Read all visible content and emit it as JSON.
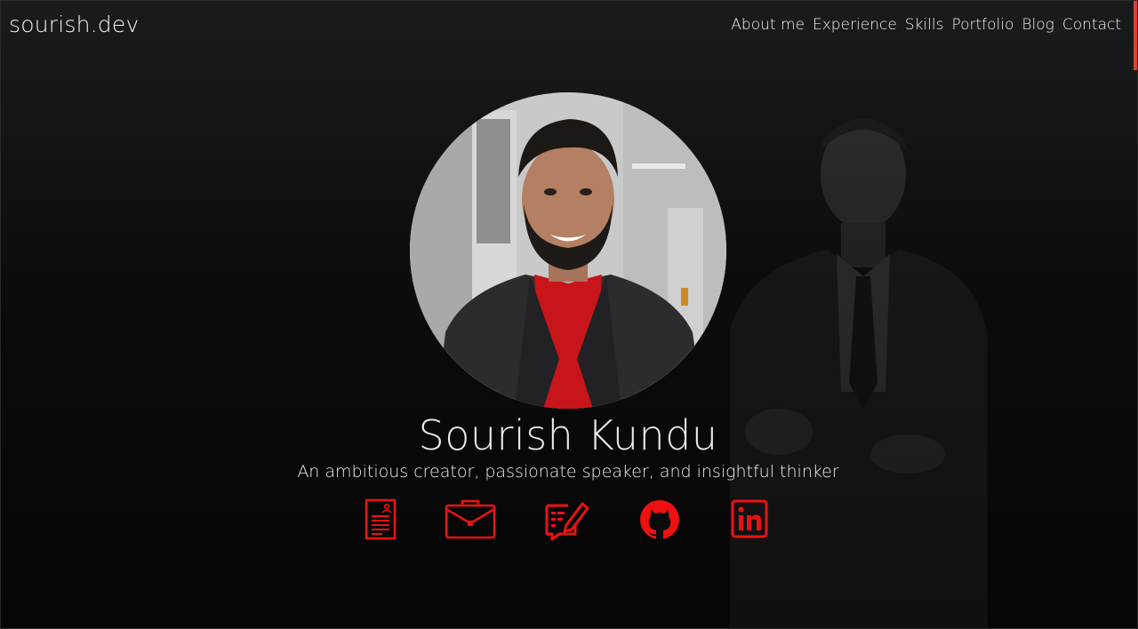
{
  "header": {
    "logo": "sourish.dev",
    "nav": [
      {
        "label": "About me"
      },
      {
        "label": "Experience"
      },
      {
        "label": "Skills"
      },
      {
        "label": "Portfolio"
      },
      {
        "label": "Blog"
      },
      {
        "label": "Contact"
      }
    ]
  },
  "hero": {
    "name": "Sourish Kundu",
    "tagline": "An ambitious creator, passionate speaker, and insightful thinker"
  },
  "social": [
    {
      "icon": "resume-icon"
    },
    {
      "icon": "briefcase-icon"
    },
    {
      "icon": "blog-icon"
    },
    {
      "icon": "github-icon"
    },
    {
      "icon": "linkedin-icon"
    }
  ],
  "colors": {
    "accent": "#ee1111",
    "background": "#0c0c0d",
    "text": "#f2f2f2",
    "scroll_indicator": "#e0402c"
  }
}
